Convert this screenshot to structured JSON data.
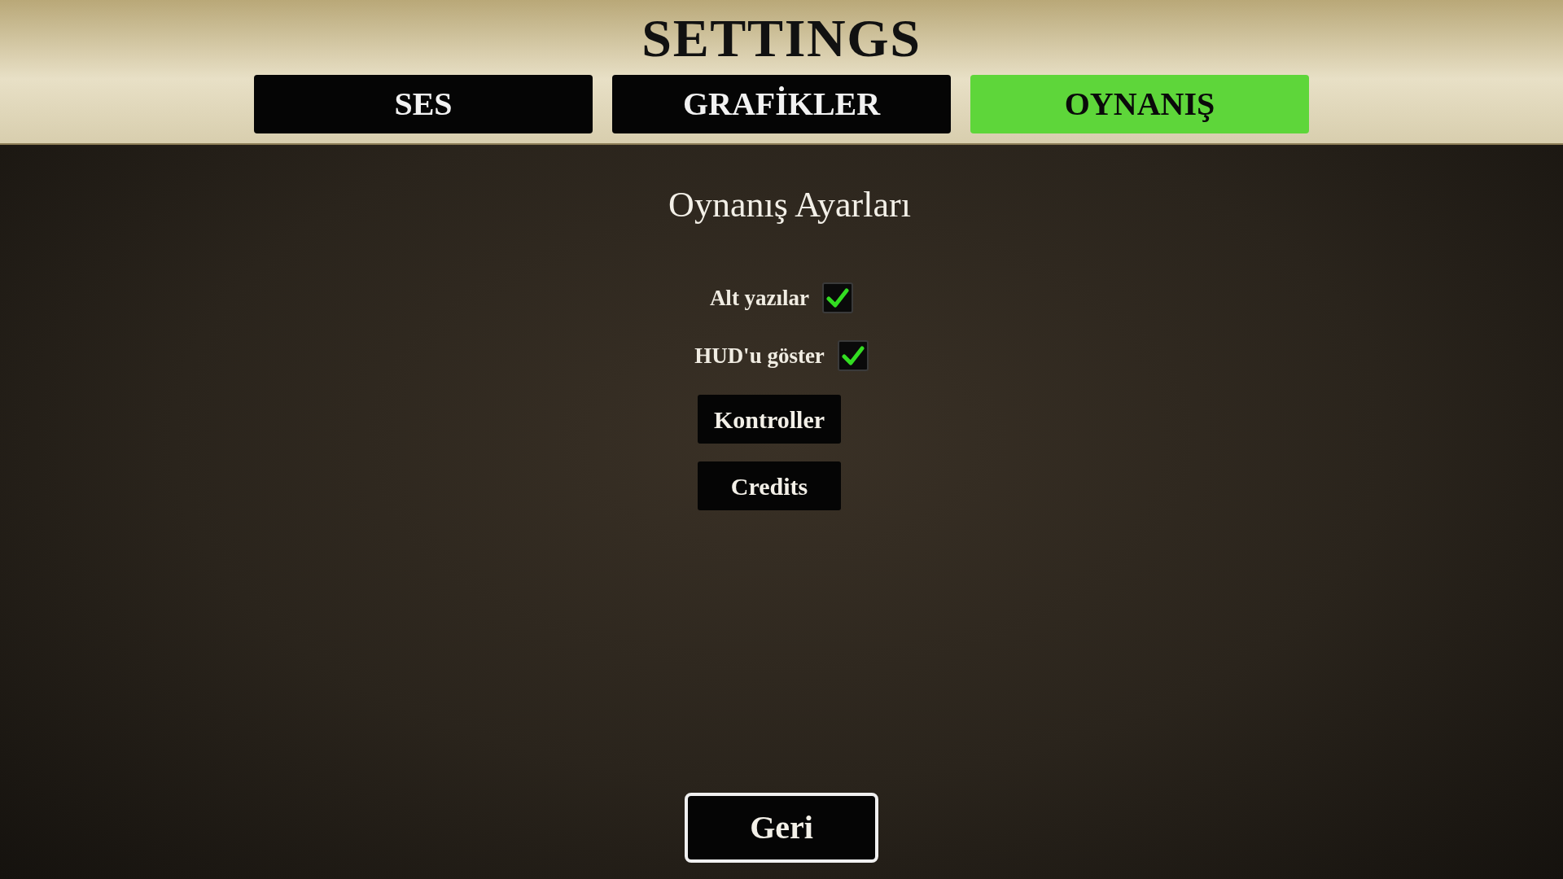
{
  "title": "SETTINGS",
  "tabs": [
    {
      "label": "SES",
      "selected": false
    },
    {
      "label": "GRAFİKLER",
      "selected": false
    },
    {
      "label": "OYNANIŞ",
      "selected": true
    }
  ],
  "section_title": "Oynanış Ayarları",
  "options": [
    {
      "label": "Alt yazılar",
      "checked": true
    },
    {
      "label": "HUD'u göster",
      "checked": true
    }
  ],
  "buttons": [
    "Kontroller",
    "Credits"
  ],
  "back_button": "Geri"
}
